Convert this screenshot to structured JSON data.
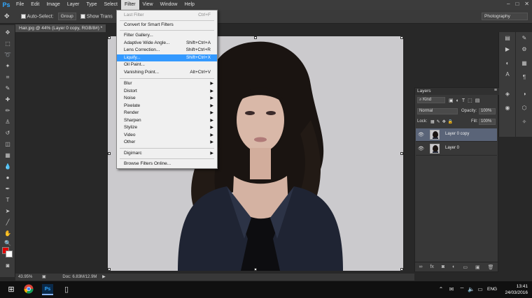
{
  "app": {
    "logo": "Ps"
  },
  "menubar": {
    "items": [
      "File",
      "Edit",
      "Image",
      "Layer",
      "Type",
      "Select",
      "Filter",
      "View",
      "Window",
      "Help"
    ],
    "active": "Filter",
    "window_controls": [
      "–",
      "□",
      "✕"
    ]
  },
  "options": {
    "auto_select_label": "Auto-Select:",
    "group_value": "Group",
    "show_transform_label": "Show Trans",
    "workspace": "Photography"
  },
  "document": {
    "tab_title": "Hair.jpg @ 44% (Layer 0 copy, RGB/8#) *",
    "zoom": "43.95%",
    "doc_size": "Doc: 6.83M/12.9M"
  },
  "filter_menu": {
    "last_filter": {
      "label": "Last Filter",
      "shortcut": "Ctrl+F"
    },
    "convert": "Convert for Smart Filters",
    "group1": [
      {
        "label": "Filter Gallery...",
        "shortcut": ""
      },
      {
        "label": "Adaptive Wide Angle...",
        "shortcut": "Shift+Ctrl+A"
      },
      {
        "label": "Lens Correction...",
        "shortcut": "Shift+Ctrl+R"
      },
      {
        "label": "Liquify...",
        "shortcut": "Shift+Ctrl+X"
      },
      {
        "label": "Oil Paint...",
        "shortcut": ""
      },
      {
        "label": "Vanishing Point...",
        "shortcut": "Alt+Ctrl+V"
      }
    ],
    "submenus": [
      "Blur",
      "Distort",
      "Noise",
      "Pixelate",
      "Render",
      "Sharpen",
      "Stylize",
      "Video",
      "Other"
    ],
    "digimarc": "Digimarc",
    "browse": "Browse Filters Online...",
    "highlighted": "Liquify..."
  },
  "layers_panel": {
    "tab": "Layers",
    "kind_label": "Kind",
    "blend_mode": "Normal",
    "opacity_label": "Opacity:",
    "opacity_value": "100%",
    "lock_label": "Lock:",
    "fill_label": "Fill:",
    "fill_value": "100%",
    "layers": [
      {
        "name": "Layer 0 copy",
        "selected": true
      },
      {
        "name": "Layer 0",
        "selected": false
      }
    ]
  },
  "taskbar": {
    "time": "13:41",
    "date": "24/03/2016",
    "language": "ENG"
  },
  "colors": {
    "foreground": "#e00000",
    "background": "#ffffff",
    "highlight": "#3399ff"
  }
}
